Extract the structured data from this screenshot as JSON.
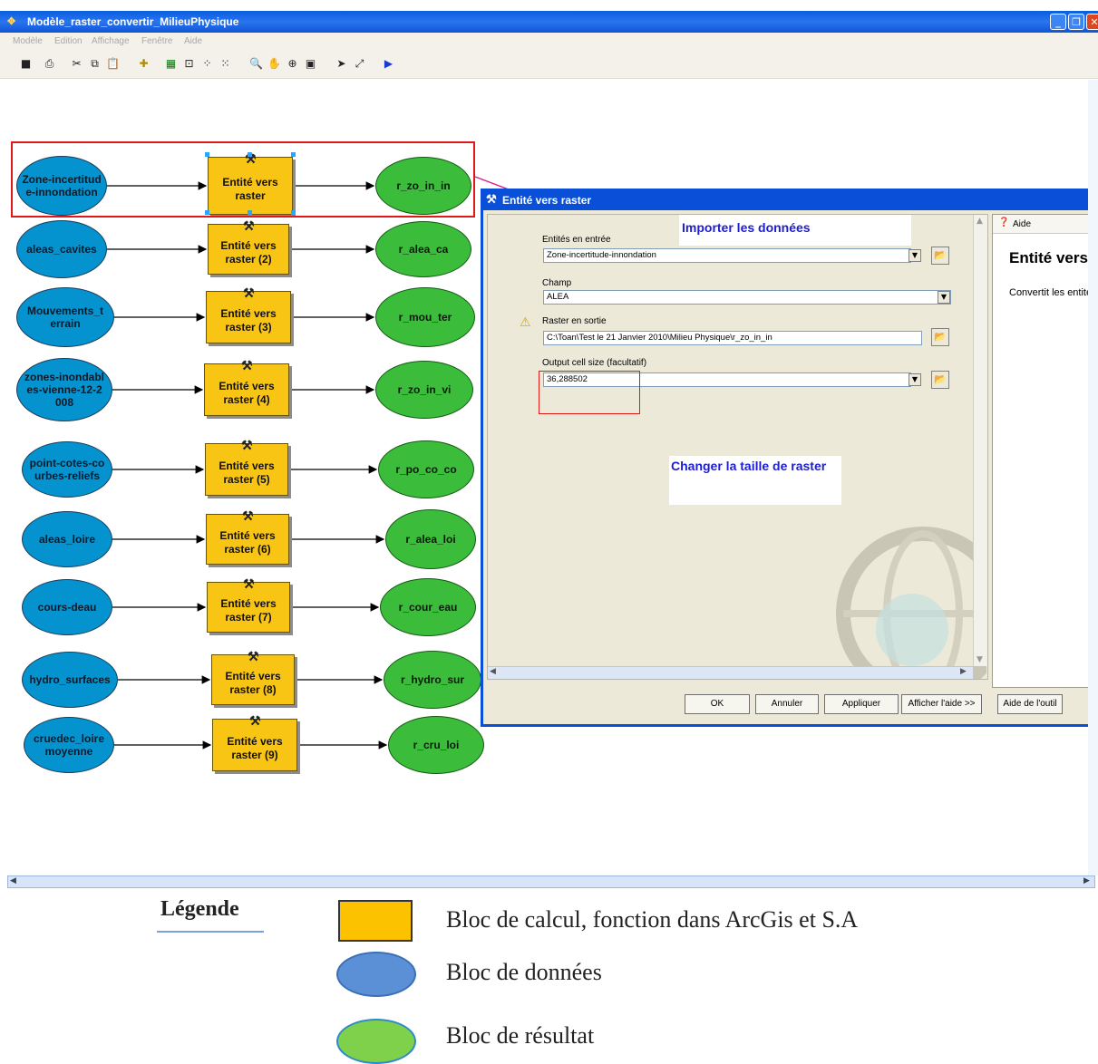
{
  "window": {
    "title": "Modèle_raster_convertir_MilieuPhysique"
  },
  "menu": [
    "Modèle",
    "Edition",
    "Affichage",
    "Fenêtre",
    "Aide"
  ],
  "model": {
    "rows": [
      {
        "input": "Zone-incertitud e-innondation",
        "tool": "Entité vers raster",
        "output": "r_zo_in_in"
      },
      {
        "input": "aleas_cavites",
        "tool": "Entité vers raster (2)",
        "output": "r_alea_ca"
      },
      {
        "input": "Mouvements_t errain",
        "tool": "Entité vers raster (3)",
        "output": "r_mou_ter"
      },
      {
        "input": "zones-inondabl es-vienne-12-2 008",
        "tool": "Entité vers raster (4)",
        "output": "r_zo_in_vi"
      },
      {
        "input": "point-cotes-co urbes-reliefs",
        "tool": "Entité vers raster (5)",
        "output": "r_po_co_co"
      },
      {
        "input": "aleas_loire",
        "tool": "Entité vers raster (6)",
        "output": "r_alea_loi"
      },
      {
        "input": "cours-deau",
        "tool": "Entité vers raster (7)",
        "output": "r_cour_eau"
      },
      {
        "input": "hydro_surfaces",
        "tool": "Entité vers raster (8)",
        "output": "r_hydro_sur"
      },
      {
        "input": "cruedec_loire moyenne",
        "tool": "Entité vers raster (9)",
        "output": "r_cru_loi"
      }
    ]
  },
  "dialog": {
    "title": "Entité vers raster",
    "callout_import": "Importer les données",
    "input_label": "Entités en entrée",
    "input_value": "Zone-incertitude-innondation",
    "field_label": "Champ",
    "field_value": "ALEA",
    "output_label": "Raster en sortie",
    "output_value": "C:\\Toan\\Test le 21 Janvier 2010\\Milieu Physique\\r_zo_in_in",
    "cellsize_label": "Output cell size (facultatif)",
    "cellsize_value": "36,288502",
    "callout_cellsize": "Changer la taille de raster",
    "buttons": {
      "ok": "OK",
      "cancel": "Annuler",
      "apply": "Appliquer",
      "show_help": "Afficher l'aide >>",
      "tool_help": "Aide de l'outil"
    },
    "help": {
      "tab": "Aide",
      "title": "Entité vers",
      "text": "Convertit les entité"
    }
  },
  "legend": {
    "title": "Légende",
    "items": [
      {
        "label": "Bloc de calcul, fonction dans ArcGis et S.A",
        "color": "#fcc200"
      },
      {
        "label": "Bloc de données",
        "color": "#5b8fd6"
      },
      {
        "label": "Bloc de résultat",
        "color": "#7fd04a"
      }
    ]
  },
  "colors": {
    "data": "#0493cf",
    "tool": "#f9c515",
    "result": "#3bbd3b",
    "highlight": "#e01818",
    "callout_text": "#1d1dd4"
  }
}
